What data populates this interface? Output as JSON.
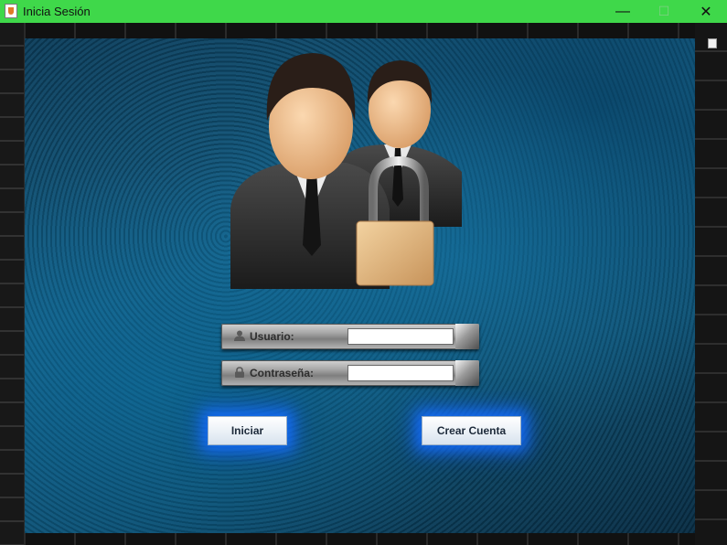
{
  "window": {
    "title": "Inicia Sesión",
    "minimize_glyph": "—",
    "maximize_glyph": "☐",
    "close_glyph": "✕"
  },
  "form": {
    "username_label": "Usuario:",
    "username_value": "",
    "password_label": "Contraseña:",
    "password_value": ""
  },
  "buttons": {
    "login_label": "Iniciar",
    "create_account_label": "Crear Cuenta"
  },
  "icons": {
    "app": "java-cup-icon",
    "user": "user-icon",
    "lock": "lock-icon",
    "illustration": "users-padlock-illustration"
  },
  "colors": {
    "titlebar": "#3fd84a",
    "button_glow": "#1464ff",
    "background_blue": "#135f86"
  }
}
